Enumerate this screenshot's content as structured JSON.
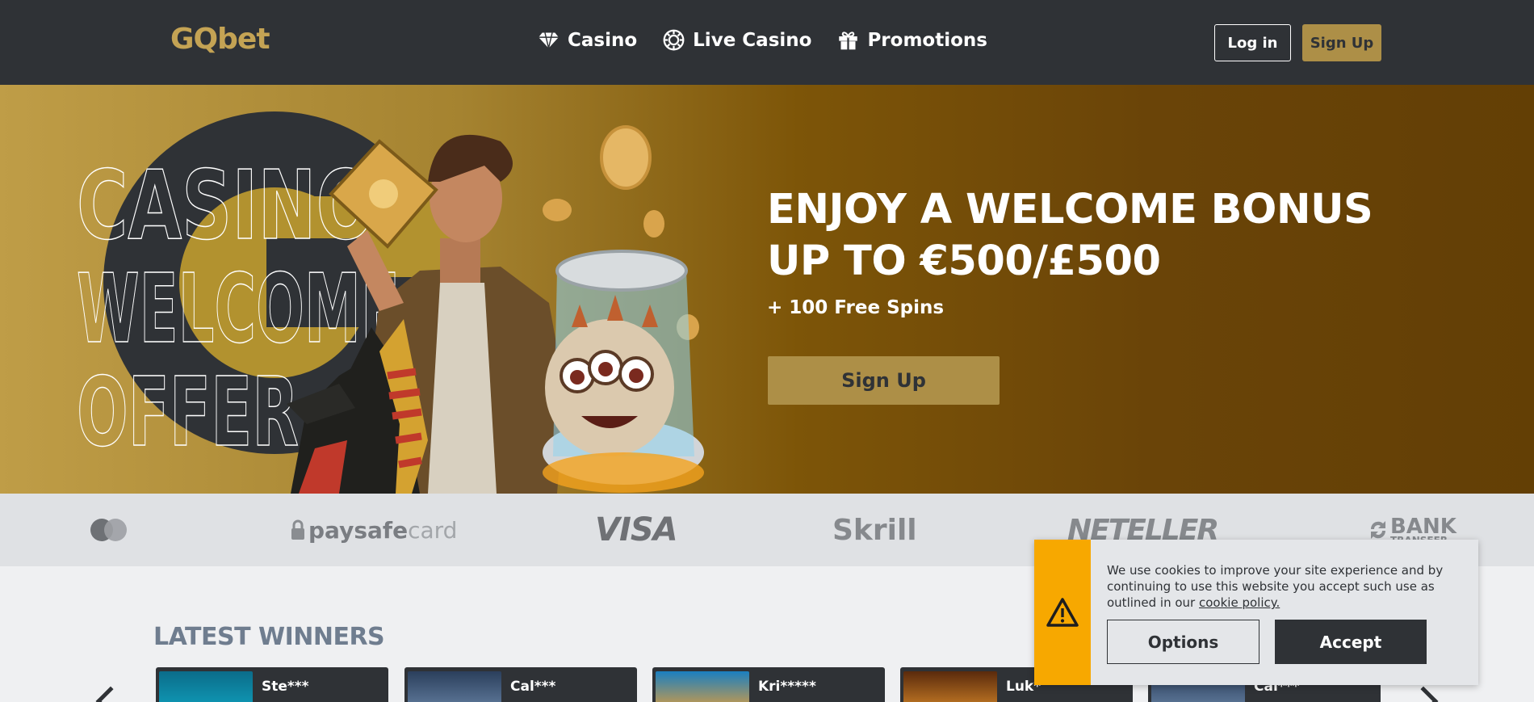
{
  "header": {
    "logo": "GQbet",
    "nav": [
      {
        "label": "Casino",
        "icon": "diamond-icon"
      },
      {
        "label": "Live Casino",
        "icon": "casino-chip-icon"
      },
      {
        "label": "Promotions",
        "icon": "gift-icon"
      }
    ],
    "login_label": "Log in",
    "signup_label": "Sign Up"
  },
  "hero": {
    "background_words": [
      "CASINO",
      "WELCOME",
      "OFFER"
    ],
    "title": "ENJOY A WELCOME BONUS UP TO €500/£500",
    "subtitle": "+ 100 Free Spins",
    "cta_label": "Sign Up"
  },
  "payments": {
    "methods": [
      "mastercard",
      "paysafecard",
      "VISA",
      "Skrill",
      "NETELLER",
      "BANK TRANSFER"
    ],
    "paysafe_a": "paysafe",
    "paysafe_b": "card",
    "visa": "VISA",
    "skrill": "Skrill",
    "neteller": "NETELLER",
    "bank": "BANK",
    "bank_sub": "TRANSFER"
  },
  "winners": {
    "title": "LATEST WINNERS",
    "items": [
      {
        "name": "Ste***"
      },
      {
        "name": "Cal***"
      },
      {
        "name": "Kri*****"
      },
      {
        "name": "Luk*"
      },
      {
        "name": "Cal***"
      }
    ]
  },
  "cookie": {
    "text": "We use cookies to improve your site experience and by continuing to use this website you accept such use as outlined in our ",
    "link": "cookie policy.",
    "options_label": "Options",
    "accept_label": "Accept"
  },
  "colors": {
    "header_bg": "#2f3236",
    "gold": "#ad8f47",
    "warning": "#f7a800"
  }
}
